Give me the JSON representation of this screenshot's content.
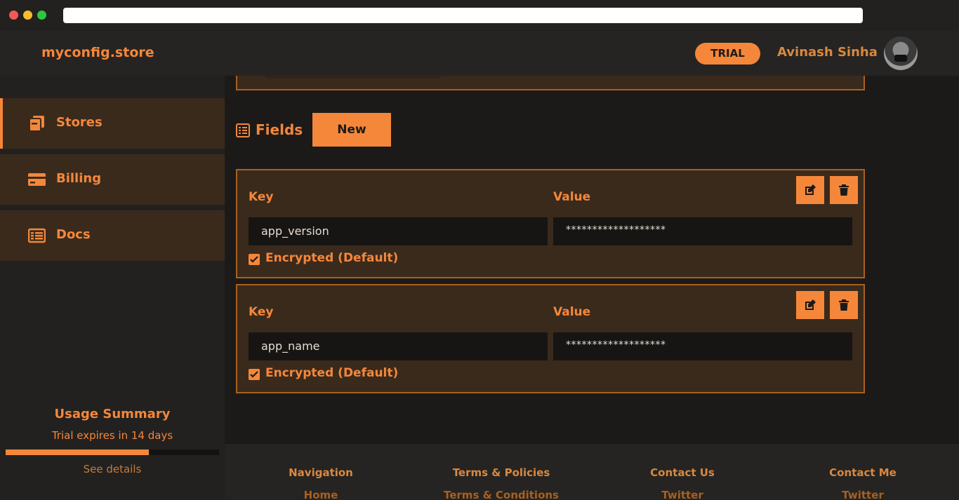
{
  "header": {
    "logo": "myconfig.store",
    "badge": "TRIAL",
    "username": "Avinash Sinha"
  },
  "sidebar": {
    "items": [
      {
        "label": "Stores",
        "icon": "stores-icon",
        "active": true
      },
      {
        "label": "Billing",
        "icon": "credit-card-icon",
        "active": false
      },
      {
        "label": "Docs",
        "icon": "docs-icon",
        "active": false
      }
    ],
    "usage": {
      "title": "Usage Summary",
      "subtitle": "Trial expires in 14 days",
      "progress_percent": 67,
      "link": "See details"
    }
  },
  "main": {
    "section_title": "Fields",
    "new_button": "New",
    "fields": [
      {
        "key_label": "Key",
        "value_label": "Value",
        "key": "app_version",
        "value": "*******************",
        "encrypted_label": "Encrypted (Default)"
      },
      {
        "key_label": "Key",
        "value_label": "Value",
        "key": "app_name",
        "value": "*******************",
        "encrypted_label": "Encrypted (Default)"
      }
    ]
  },
  "footer": {
    "columns": [
      {
        "heading": "Navigation",
        "link": "Home"
      },
      {
        "heading": "Terms & Policies",
        "link": "Terms & Conditions"
      },
      {
        "heading": "Contact Us",
        "link": "Twitter"
      },
      {
        "heading": "Contact Me",
        "link": "Twitter"
      }
    ]
  },
  "colors": {
    "accent": "#f5873a",
    "card_bg": "#3a2a1c",
    "card_border": "#a9601f",
    "page_bg": "#1c1a19"
  }
}
